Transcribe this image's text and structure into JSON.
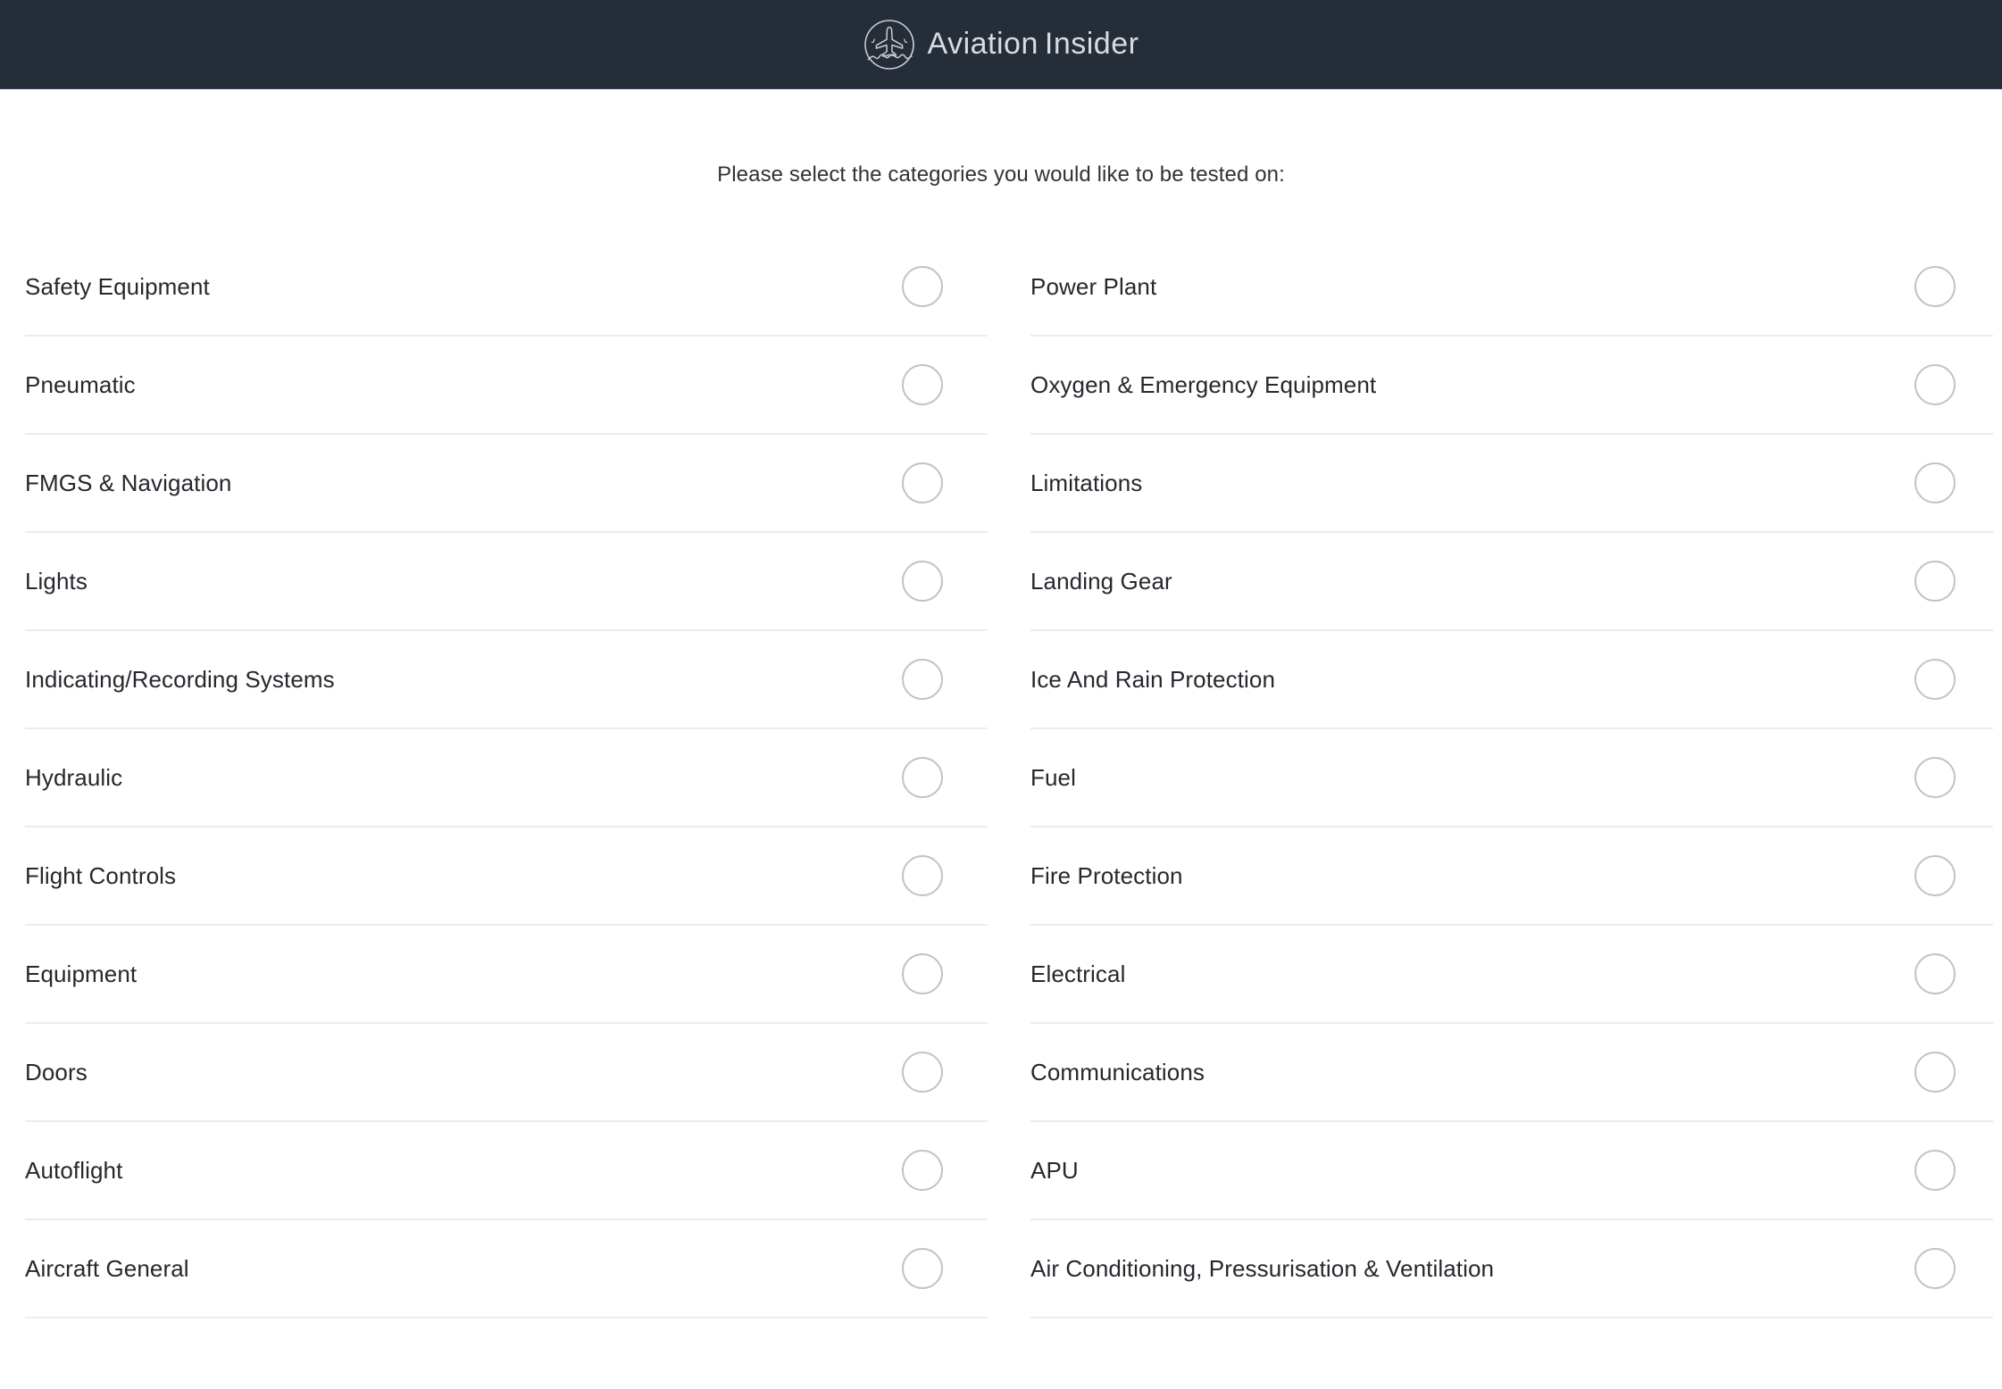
{
  "header": {
    "brand_first": "Aviation",
    "brand_second": "Insider",
    "logo_icon": "airplane-in-circle-logo-icon",
    "background_color": "#252d38",
    "text_color": "#d9dbdf"
  },
  "main": {
    "instruction": "Please select the categories you would like to be tested on:",
    "toggle_icon": "empty-circle-icon",
    "toggle_border_color": "#c3c3c3",
    "divider_color": "#ececec",
    "columns": [
      {
        "name": "left",
        "items": [
          {
            "label": "Safety Equipment",
            "selected": false
          },
          {
            "label": "Pneumatic",
            "selected": false
          },
          {
            "label": "FMGS & Navigation",
            "selected": false
          },
          {
            "label": "Lights",
            "selected": false
          },
          {
            "label": "Indicating/Recording Systems",
            "selected": false
          },
          {
            "label": "Hydraulic",
            "selected": false
          },
          {
            "label": "Flight Controls",
            "selected": false
          },
          {
            "label": "Equipment",
            "selected": false
          },
          {
            "label": "Doors",
            "selected": false
          },
          {
            "label": "Autoflight",
            "selected": false
          },
          {
            "label": "Aircraft General",
            "selected": false
          }
        ]
      },
      {
        "name": "right",
        "items": [
          {
            "label": "Power Plant",
            "selected": false
          },
          {
            "label": "Oxygen & Emergency Equipment",
            "selected": false
          },
          {
            "label": "Limitations",
            "selected": false
          },
          {
            "label": "Landing Gear",
            "selected": false
          },
          {
            "label": "Ice And Rain Protection",
            "selected": false
          },
          {
            "label": "Fuel",
            "selected": false
          },
          {
            "label": "Fire Protection",
            "selected": false
          },
          {
            "label": "Electrical",
            "selected": false
          },
          {
            "label": "Communications",
            "selected": false
          },
          {
            "label": "APU",
            "selected": false
          },
          {
            "label": "Air Conditioning, Pressurisation & Ventilation",
            "selected": false
          }
        ]
      }
    ]
  }
}
